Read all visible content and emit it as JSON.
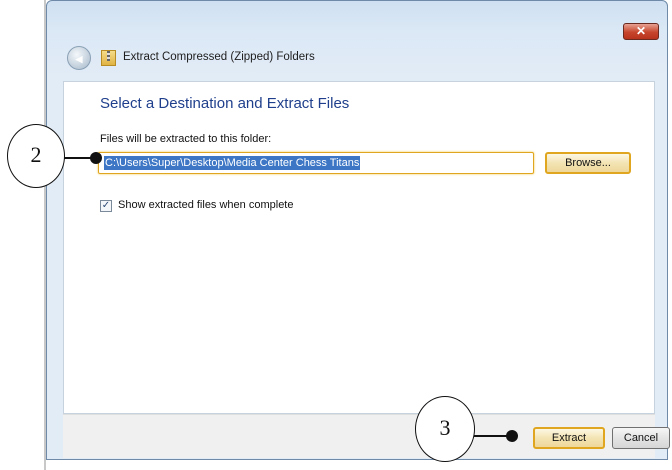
{
  "window": {
    "title": "Extract Compressed (Zipped) Folders",
    "close_symbol": "✕",
    "back_symbol": "◀"
  },
  "content": {
    "heading": "Select a Destination and Extract Files",
    "path_label": "Files will be extracted to this folder:",
    "path_value": "C:\\Users\\Super\\Desktop\\Media Center Chess Titans",
    "browse_label": "Browse...",
    "show_files_checked": true,
    "show_files_label": "Show extracted files when complete"
  },
  "footer": {
    "extract_label": "Extract",
    "cancel_label": "Cancel"
  },
  "callouts": {
    "c2": "2",
    "c3": "3"
  },
  "icons": [
    "close-icon",
    "back-arrow-icon",
    "zip-folder-icon",
    "checkmark-icon"
  ],
  "colors": {
    "heading": "#1f3f8c",
    "selection": "#3c76c5",
    "focus": "#e0a620"
  }
}
